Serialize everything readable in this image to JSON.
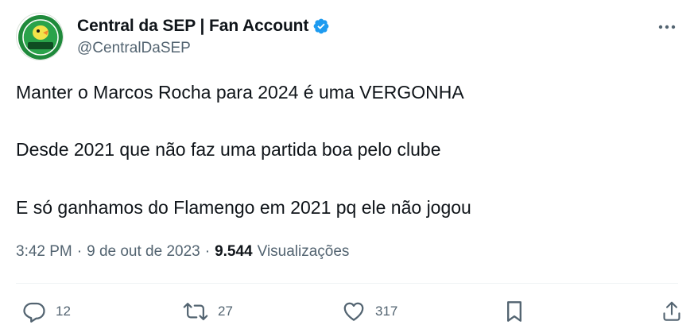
{
  "user": {
    "display_name": "Central da SEP | Fan Account",
    "handle": "@CentralDaSEP",
    "avatar_text": "CENTRAL DA SEP",
    "verified": true
  },
  "tweet": {
    "lines": [
      "Manter o Marcos Rocha para 2024 é uma VERGONHA",
      "Desde 2021 que não faz uma partida boa pelo clube",
      "E só ganhamos do Flamengo em 2021 pq ele não jogou"
    ],
    "time": "3:42 PM",
    "separator": "·",
    "date": "9 de out de 2023",
    "views_count": "9.544",
    "views_label": "Visualizações"
  },
  "actions": {
    "reply": {
      "icon": "reply-icon",
      "count": "12"
    },
    "retweet": {
      "icon": "retweet-icon",
      "count": "27"
    },
    "like": {
      "icon": "heart-icon",
      "count": "317"
    },
    "bookmark": {
      "icon": "bookmark-icon"
    },
    "share": {
      "icon": "share-icon"
    }
  },
  "colors": {
    "text_primary": "#0f1419",
    "text_secondary": "#536471",
    "verified_blue": "#1d9bf0",
    "avatar_green": "#1f8a3b",
    "divider": "#eff3f4"
  }
}
